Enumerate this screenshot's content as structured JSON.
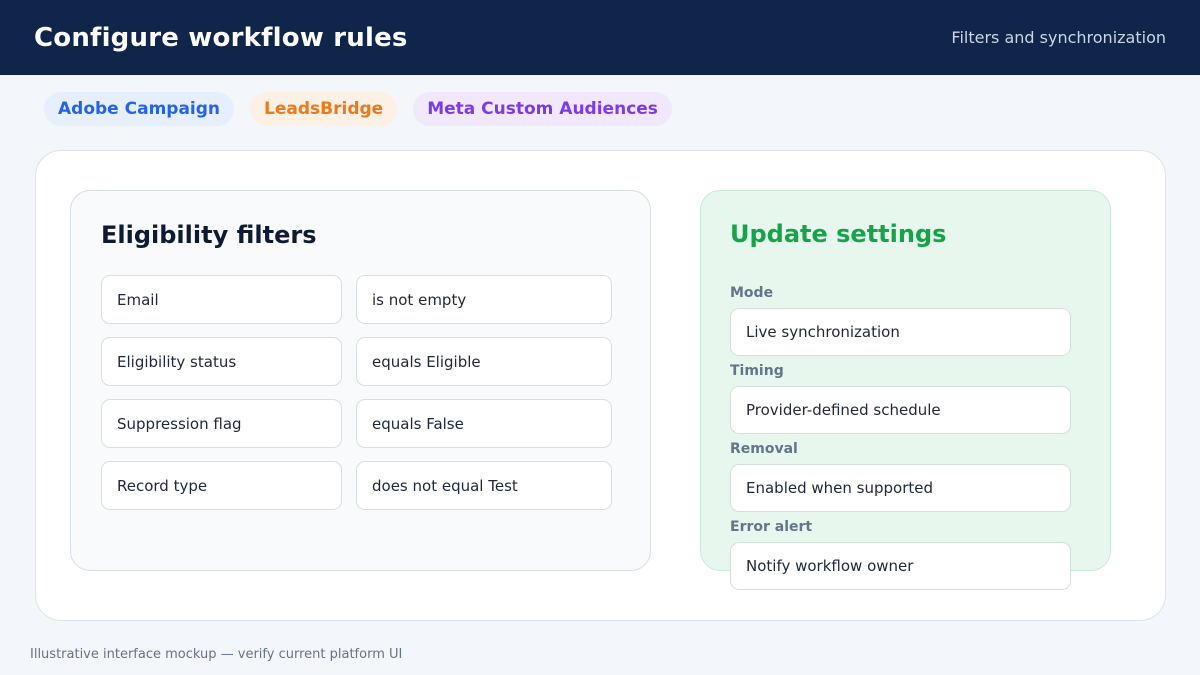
{
  "header": {
    "title": "Configure workflow rules",
    "subtitle": "Filters and synchronization"
  },
  "tags": [
    {
      "label": "Adobe Campaign",
      "color": "#2563eb"
    },
    {
      "label": "LeadsBridge",
      "color": "#ea7a1a"
    },
    {
      "label": "Meta Custom Audiences",
      "color": "#7c3aed"
    }
  ],
  "filters": {
    "title": "Eligibility filters",
    "rows": [
      {
        "field": "Email",
        "condition": "is not empty"
      },
      {
        "field": "Eligibility status",
        "condition": "equals Eligible"
      },
      {
        "field": "Suppression flag",
        "condition": "equals False"
      },
      {
        "field": "Record type",
        "condition": "does not equal Test"
      }
    ]
  },
  "settings": {
    "title": "Update settings",
    "accent": "#16a34a",
    "items": [
      {
        "label": "Mode",
        "value": "Live synchronization"
      },
      {
        "label": "Timing",
        "value": "Provider-defined schedule"
      },
      {
        "label": "Removal",
        "value": "Enabled when supported"
      },
      {
        "label": "Error alert",
        "value": "Notify workflow owner"
      }
    ]
  },
  "footnote": "Illustrative interface mockup — verify current platform UI"
}
